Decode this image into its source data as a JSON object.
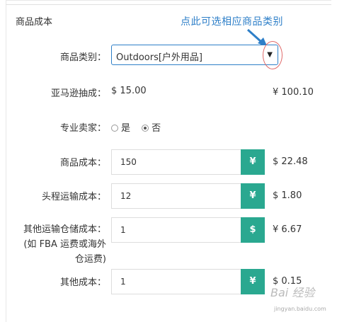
{
  "section_title": "商品成本",
  "annotation": "点此可选相应商品类别",
  "category": {
    "label": "商品类别：",
    "value": "Outdoors[户外用品]"
  },
  "amazon_fee": {
    "label": "亚马逊抽成：",
    "usd": "$ 15.00",
    "cny": "¥ 100.10"
  },
  "pro_seller": {
    "label": "专业卖家：",
    "options": [
      "是",
      "否"
    ],
    "selected": "否"
  },
  "rows": [
    {
      "label": "商品成本：",
      "value": "150",
      "addon": "¥",
      "result": "$ 22.48"
    },
    {
      "label": "头程运输成本：",
      "value": "12",
      "addon": "¥",
      "result": "$ 1.80"
    },
    {
      "label_lines": [
        "其他运输仓储成本：",
        "(如 FBA 运费或海外",
        "仓运费)"
      ],
      "value": "1",
      "addon": "$",
      "result": "¥ 6.67"
    },
    {
      "label": "其他成本：",
      "value": "1",
      "addon": "¥",
      "result": "$ 0.15"
    }
  ],
  "watermark": {
    "text": "Bai 经验",
    "sub": "jingyan.baidu.com"
  },
  "colors": {
    "accent_blue": "#2e7fc8",
    "addon_green": "#2aa890",
    "mark_red": "#e06a6a"
  }
}
